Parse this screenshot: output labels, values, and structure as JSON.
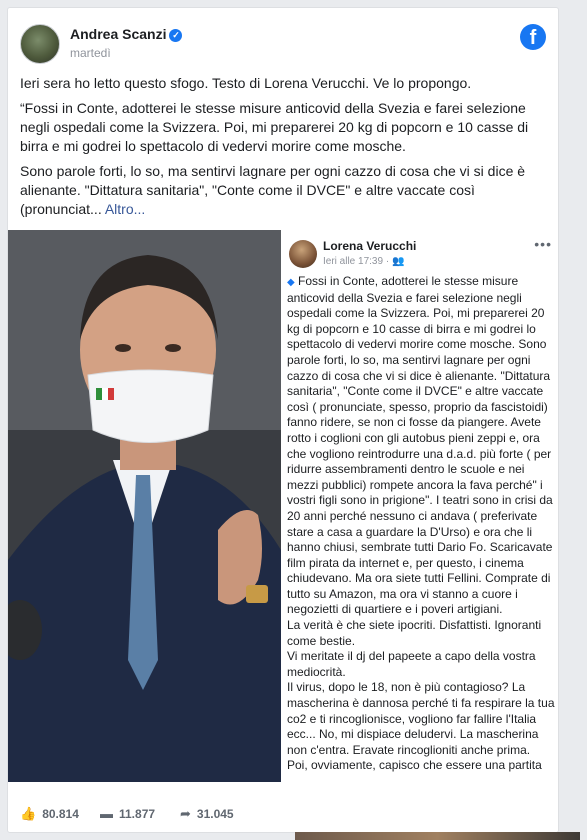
{
  "post": {
    "author": "Andrea Scanzi",
    "timestamp": "martedì",
    "paragraphs": [
      "Ieri sera ho letto questo sfogo. Testo di Lorena Verucchi. Ve lo propongo.",
      "“Fossi in Conte, adotterei le stesse misure anticovid della Svezia e farei selezione negli ospedali come la Svizzera. Poi, mi preparerei 20 kg di popcorn e 10 casse di birra e mi godrei lo spettacolo di vedervi morire come mosche."
    ],
    "last_paragraph": "Sono parole forti, lo so, ma sentirvi lagnare per ogni cazzo di cosa che vi si dice è alienante. \"Dittatura sanitaria\", \"Conte come il DVCE\" e altre vaccate così (pronunciat...",
    "see_more": "Altro..."
  },
  "embedded_post": {
    "author": "Lorena Verucchi",
    "timestamp": "Ieri alle 17:39 · ",
    "text": "Fossi in Conte, adotterei le stesse misure anticovid della Svezia e farei selezione negli ospedali come la Svizzera. Poi, mi preparerei 20 kg di popcorn e 10 casse di birra e mi godrei lo spettacolo di vedervi morire come mosche. Sono parole forti, lo so, ma sentirvi lagnare per ogni cazzo di cosa che vi si dice è alienante. \"Dittatura sanitaria\", \"Conte come il DVCE\" e altre vaccate così ( pronunciate, spesso, proprio da fascistoidi) fanno ridere, se non ci fosse da piangere. Avete rotto i coglioni con gli autobus pieni zeppi e, ora che vogliono reintrodurre una d.a.d. più forte ( per ridurre assembramenti dentro le scuole e nei mezzi pubblici) rompete ancora la fava perché\" i vostri figli sono in prigione\". I teatri sono in crisi da 20 anni perché nessuno ci andava ( preferivate stare a casa a guardare la D'Urso) e ora che li hanno chiusi, sembrate tutti Dario Fo. Scaricavate film pirata da internet e, per questo, i cinema chiudevano. Ma ora siete tutti Fellini. Comprate di tutto su Amazon, ma ora vi stanno a cuore i negozietti di quartiere e i poveri artigiani.",
    "line2": "La verità è che siete ipocriti. Disfattisti. Ignoranti come bestie.",
    "line3": "Vi meritate il dj del papeete a capo della vostra mediocrità.",
    "line4": "Il virus, dopo le 18, non è più contagioso? La mascherina è dannosa perché ti fa respirare la tua co2 e ti rincoglionisce, vogliono far fallire l'Italia ecc... No, mi dispiace deludervi. La mascherina non c'entra. Eravate rincoglioniti anche prima.",
    "line5": "Poi, ovviamente, capisco che essere una partita"
  },
  "footer": {
    "likes": "80.814",
    "comments": "11.877",
    "shares": "31.045"
  },
  "colors": {
    "facebook_blue": "#1877f2",
    "link": "#385898",
    "meta_gray": "#90949c"
  },
  "icons": {
    "verified": "verified-badge-icon",
    "facebook": "facebook-logo-icon",
    "like": "thumbs-up-icon",
    "comment": "comment-icon",
    "share": "share-arrow-icon",
    "more": "more-dots-icon"
  }
}
